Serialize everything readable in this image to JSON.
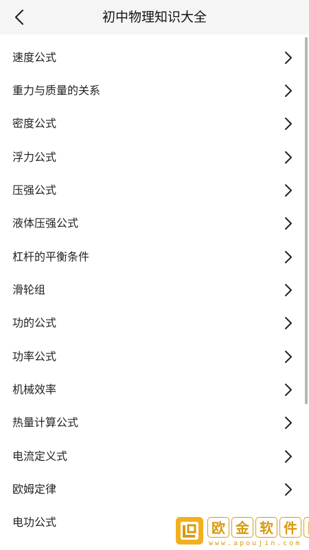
{
  "header": {
    "title": "初中物理知识大全"
  },
  "list": {
    "items": [
      {
        "label": "速度公式"
      },
      {
        "label": "重力与质量的关系"
      },
      {
        "label": "密度公式"
      },
      {
        "label": "浮力公式"
      },
      {
        "label": "压强公式"
      },
      {
        "label": "液体压强公式"
      },
      {
        "label": "杠杆的平衡条件"
      },
      {
        "label": "滑轮组"
      },
      {
        "label": "功的公式"
      },
      {
        "label": "功率公式"
      },
      {
        "label": "机械效率"
      },
      {
        "label": "热量计算公式"
      },
      {
        "label": "电流定义式"
      },
      {
        "label": "欧姆定律"
      },
      {
        "label": "电功公式"
      }
    ]
  },
  "watermark": {
    "chars": [
      "欧",
      "金",
      "软",
      "件",
      "园"
    ],
    "url": "www.apoujin.com",
    "color": "#d89a10"
  },
  "icons": {
    "back": "back-arrow-icon",
    "item_arrow": "chevron-right-icon",
    "logo": "apoujin-logo-icon"
  }
}
